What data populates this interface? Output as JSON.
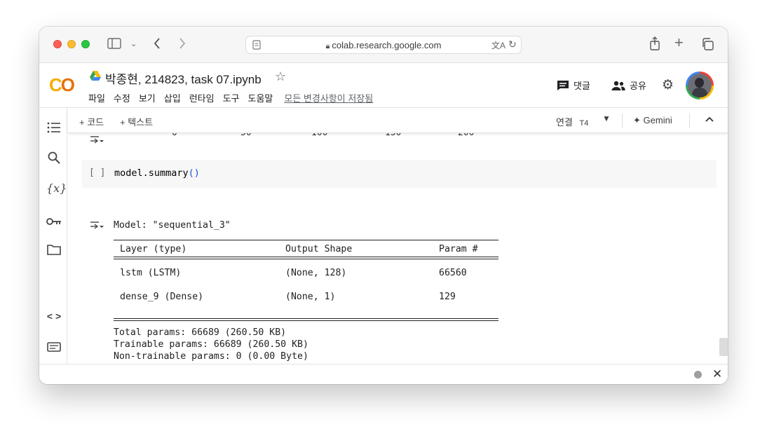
{
  "browser": {
    "url": "colab.research.google.com"
  },
  "header": {
    "notebook_title": "박종현, 214823, task 07.ipynb",
    "menu": [
      "파일",
      "수정",
      "보기",
      "삽입",
      "런타임",
      "도구",
      "도움말"
    ],
    "saved_status": "모든 변경사항이 저장됨",
    "comment_label": "댓글",
    "share_label": "공유"
  },
  "toolbar": {
    "add_code": "+ 코드",
    "add_text": "+ 텍스트",
    "connect_label": "연결",
    "runtime": "T4",
    "gemini": "Gemini"
  },
  "prev_axis_ticks": [
    "0",
    "50",
    "100",
    "150",
    "200"
  ],
  "cell": {
    "exec_count": "[ ]",
    "code": "model.summary",
    "code_parens": "()"
  },
  "output": {
    "model_line": "Model: \"sequential_3\"",
    "headers": {
      "layer": "Layer (type)",
      "shape": "Output Shape",
      "params": "Param #"
    },
    "rows": [
      {
        "layer": "lstm (LSTM)",
        "shape": "(None, 128)",
        "params": "66560"
      },
      {
        "layer": "dense_9 (Dense)",
        "shape": "(None, 1)",
        "params": "129"
      }
    ],
    "total": "Total params: 66689 (260.50 KB)",
    "trainable": "Trainable params: 66689 (260.50 KB)",
    "non_trainable": "Non-trainable params: 0 (0.00 Byte)"
  }
}
